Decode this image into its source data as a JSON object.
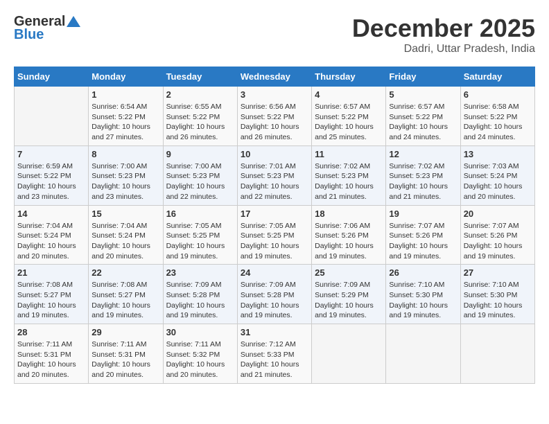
{
  "header": {
    "logo_general": "General",
    "logo_blue": "Blue",
    "month": "December 2025",
    "location": "Dadri, Uttar Pradesh, India"
  },
  "weekdays": [
    "Sunday",
    "Monday",
    "Tuesday",
    "Wednesday",
    "Thursday",
    "Friday",
    "Saturday"
  ],
  "weeks": [
    [
      {
        "day": "",
        "info": ""
      },
      {
        "day": "1",
        "info": "Sunrise: 6:54 AM\nSunset: 5:22 PM\nDaylight: 10 hours\nand 27 minutes."
      },
      {
        "day": "2",
        "info": "Sunrise: 6:55 AM\nSunset: 5:22 PM\nDaylight: 10 hours\nand 26 minutes."
      },
      {
        "day": "3",
        "info": "Sunrise: 6:56 AM\nSunset: 5:22 PM\nDaylight: 10 hours\nand 26 minutes."
      },
      {
        "day": "4",
        "info": "Sunrise: 6:57 AM\nSunset: 5:22 PM\nDaylight: 10 hours\nand 25 minutes."
      },
      {
        "day": "5",
        "info": "Sunrise: 6:57 AM\nSunset: 5:22 PM\nDaylight: 10 hours\nand 24 minutes."
      },
      {
        "day": "6",
        "info": "Sunrise: 6:58 AM\nSunset: 5:22 PM\nDaylight: 10 hours\nand 24 minutes."
      }
    ],
    [
      {
        "day": "7",
        "info": "Sunrise: 6:59 AM\nSunset: 5:22 PM\nDaylight: 10 hours\nand 23 minutes."
      },
      {
        "day": "8",
        "info": "Sunrise: 7:00 AM\nSunset: 5:23 PM\nDaylight: 10 hours\nand 23 minutes."
      },
      {
        "day": "9",
        "info": "Sunrise: 7:00 AM\nSunset: 5:23 PM\nDaylight: 10 hours\nand 22 minutes."
      },
      {
        "day": "10",
        "info": "Sunrise: 7:01 AM\nSunset: 5:23 PM\nDaylight: 10 hours\nand 22 minutes."
      },
      {
        "day": "11",
        "info": "Sunrise: 7:02 AM\nSunset: 5:23 PM\nDaylight: 10 hours\nand 21 minutes."
      },
      {
        "day": "12",
        "info": "Sunrise: 7:02 AM\nSunset: 5:23 PM\nDaylight: 10 hours\nand 21 minutes."
      },
      {
        "day": "13",
        "info": "Sunrise: 7:03 AM\nSunset: 5:24 PM\nDaylight: 10 hours\nand 20 minutes."
      }
    ],
    [
      {
        "day": "14",
        "info": "Sunrise: 7:04 AM\nSunset: 5:24 PM\nDaylight: 10 hours\nand 20 minutes."
      },
      {
        "day": "15",
        "info": "Sunrise: 7:04 AM\nSunset: 5:24 PM\nDaylight: 10 hours\nand 20 minutes."
      },
      {
        "day": "16",
        "info": "Sunrise: 7:05 AM\nSunset: 5:25 PM\nDaylight: 10 hours\nand 19 minutes."
      },
      {
        "day": "17",
        "info": "Sunrise: 7:05 AM\nSunset: 5:25 PM\nDaylight: 10 hours\nand 19 minutes."
      },
      {
        "day": "18",
        "info": "Sunrise: 7:06 AM\nSunset: 5:26 PM\nDaylight: 10 hours\nand 19 minutes."
      },
      {
        "day": "19",
        "info": "Sunrise: 7:07 AM\nSunset: 5:26 PM\nDaylight: 10 hours\nand 19 minutes."
      },
      {
        "day": "20",
        "info": "Sunrise: 7:07 AM\nSunset: 5:26 PM\nDaylight: 10 hours\nand 19 minutes."
      }
    ],
    [
      {
        "day": "21",
        "info": "Sunrise: 7:08 AM\nSunset: 5:27 PM\nDaylight: 10 hours\nand 19 minutes."
      },
      {
        "day": "22",
        "info": "Sunrise: 7:08 AM\nSunset: 5:27 PM\nDaylight: 10 hours\nand 19 minutes."
      },
      {
        "day": "23",
        "info": "Sunrise: 7:09 AM\nSunset: 5:28 PM\nDaylight: 10 hours\nand 19 minutes."
      },
      {
        "day": "24",
        "info": "Sunrise: 7:09 AM\nSunset: 5:28 PM\nDaylight: 10 hours\nand 19 minutes."
      },
      {
        "day": "25",
        "info": "Sunrise: 7:09 AM\nSunset: 5:29 PM\nDaylight: 10 hours\nand 19 minutes."
      },
      {
        "day": "26",
        "info": "Sunrise: 7:10 AM\nSunset: 5:30 PM\nDaylight: 10 hours\nand 19 minutes."
      },
      {
        "day": "27",
        "info": "Sunrise: 7:10 AM\nSunset: 5:30 PM\nDaylight: 10 hours\nand 19 minutes."
      }
    ],
    [
      {
        "day": "28",
        "info": "Sunrise: 7:11 AM\nSunset: 5:31 PM\nDaylight: 10 hours\nand 20 minutes."
      },
      {
        "day": "29",
        "info": "Sunrise: 7:11 AM\nSunset: 5:31 PM\nDaylight: 10 hours\nand 20 minutes."
      },
      {
        "day": "30",
        "info": "Sunrise: 7:11 AM\nSunset: 5:32 PM\nDaylight: 10 hours\nand 20 minutes."
      },
      {
        "day": "31",
        "info": "Sunrise: 7:12 AM\nSunset: 5:33 PM\nDaylight: 10 hours\nand 21 minutes."
      },
      {
        "day": "",
        "info": ""
      },
      {
        "day": "",
        "info": ""
      },
      {
        "day": "",
        "info": ""
      }
    ]
  ]
}
